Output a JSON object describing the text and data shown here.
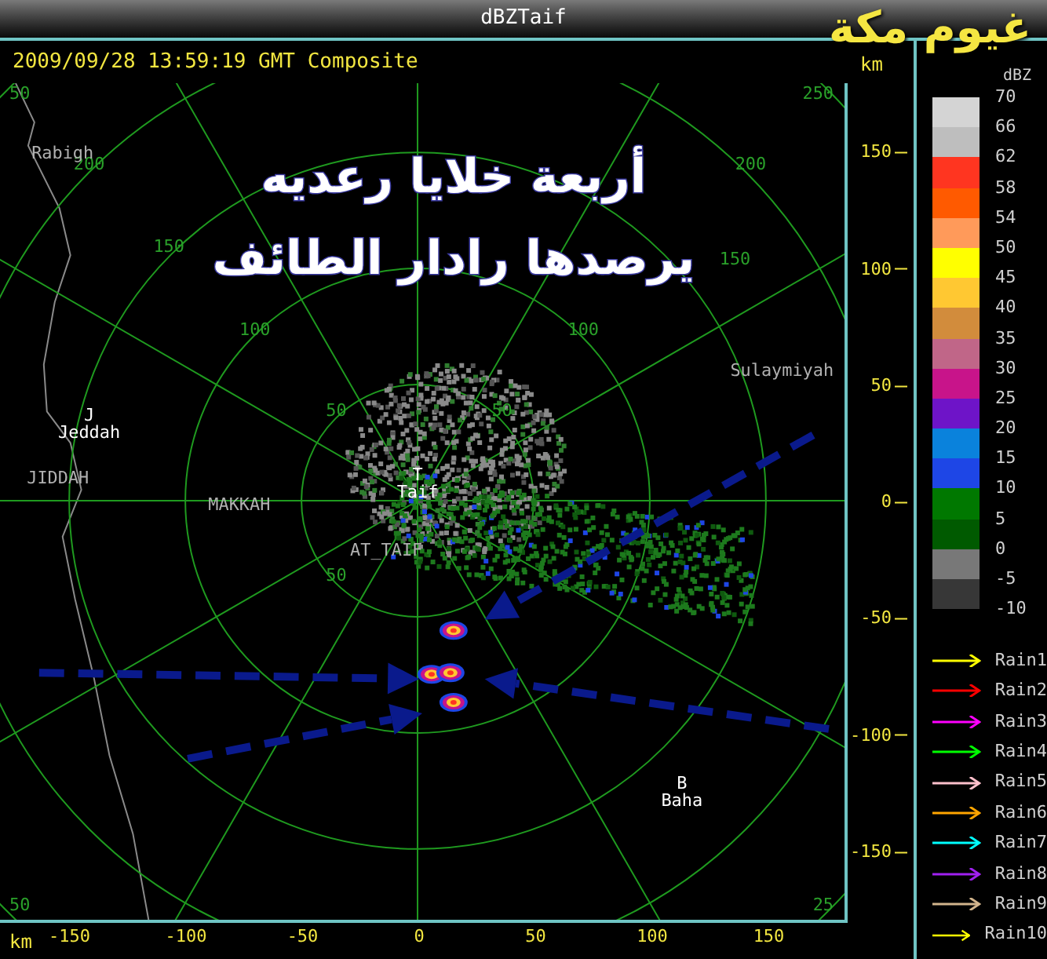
{
  "window": {
    "title": "dBZTaif"
  },
  "logo_text": "غيوم مكة",
  "info_line": "2009/09/28 13:59:19 GMT Composite",
  "map": {
    "overlay_lines": [
      "أربعة خلايا رعديه",
      "يرصدها رادار الطائف"
    ],
    "ring_labels_nw": [
      "50",
      "100",
      "150",
      "200"
    ],
    "ring_labels_ne": [
      "50",
      "100",
      "150",
      "200"
    ],
    "ring_label_sw": "50",
    "corner_labels": [
      "50",
      "250",
      "50",
      "25"
    ],
    "places": [
      {
        "name": "Rabigh",
        "kind": "region"
      },
      {
        "name": "Jeddah",
        "marker": "J",
        "kind": "site"
      },
      {
        "name": "JIDDAH",
        "kind": "region"
      },
      {
        "name": "MAKKAH",
        "kind": "region"
      },
      {
        "name": "Taif",
        "marker": "T",
        "kind": "site"
      },
      {
        "name": "AT_TAIF",
        "kind": "region"
      },
      {
        "name": "Sulaymiyah",
        "kind": "region"
      },
      {
        "name": "Baha",
        "marker": "B",
        "kind": "site"
      }
    ]
  },
  "y_axis": {
    "unit": "km",
    "labels": [
      "150",
      "100",
      "50",
      "0",
      "-50",
      "-100",
      "-150"
    ]
  },
  "x_axis": {
    "unit": "km",
    "labels": [
      "-150",
      "-100",
      "-50",
      "0",
      "50",
      "100",
      "150"
    ]
  },
  "legend": {
    "title": "dBZ",
    "levels": [
      {
        "label": "70",
        "color": "#d4d4d4"
      },
      {
        "label": "66",
        "color": "#bebebe"
      },
      {
        "label": "62",
        "color": "#ff3520"
      },
      {
        "label": "58",
        "color": "#ff5a00"
      },
      {
        "label": "54",
        "color": "#ff9a5a"
      },
      {
        "label": "50",
        "color": "#ffff00"
      },
      {
        "label": "45",
        "color": "#ffc832"
      },
      {
        "label": "40",
        "color": "#d28c3c"
      },
      {
        "label": "35",
        "color": "#c06688"
      },
      {
        "label": "30",
        "color": "#c8148a"
      },
      {
        "label": "25",
        "color": "#6e14c8"
      },
      {
        "label": "20",
        "color": "#0a82dc"
      },
      {
        "label": "15",
        "color": "#1e46e6"
      },
      {
        "label": "10",
        "color": "#007800"
      },
      {
        "label": "5",
        "color": "#005a00"
      },
      {
        "label": "0",
        "color": "#787878"
      },
      {
        "label": "-5",
        "color": "#373737"
      },
      {
        "label": "-10"
      }
    ],
    "tracks": [
      {
        "label": "Rain1",
        "color": "#ffff00"
      },
      {
        "label": "Rain2",
        "color": "#ff0000"
      },
      {
        "label": "Rain3",
        "color": "#ff00ff"
      },
      {
        "label": "Rain4",
        "color": "#00ff00"
      },
      {
        "label": "Rain5",
        "color": "#ffc0cb"
      },
      {
        "label": "Rain6",
        "color": "#ffa500"
      },
      {
        "label": "Rain7",
        "color": "#00ffff"
      },
      {
        "label": "Rain8",
        "color": "#a020f0"
      },
      {
        "label": "Rain9",
        "color": "#d2b48c"
      },
      {
        "label": "Rain10",
        "color": "#ffff00"
      }
    ]
  }
}
